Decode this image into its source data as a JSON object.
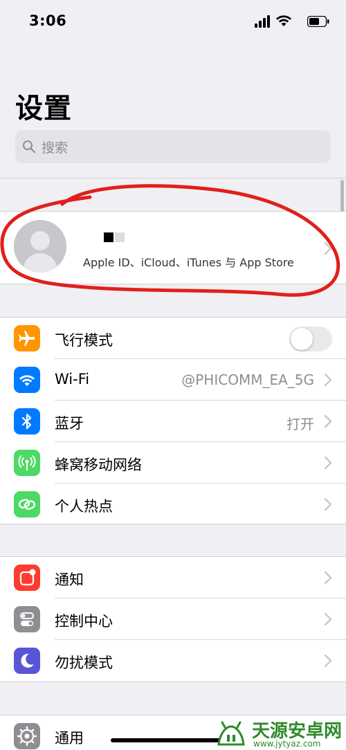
{
  "status_bar": {
    "time": "3:06"
  },
  "title": "设置",
  "search": {
    "placeholder": "搜索"
  },
  "profile": {
    "subtitle": "Apple ID、iCloud、iTunes 与 App Store"
  },
  "network_group": [
    {
      "label": "飞行模式",
      "value": "",
      "icon": "airplane-icon",
      "color": "#ff9500",
      "toggle": false
    },
    {
      "label": "Wi-Fi",
      "value": "@PHICOMM_EA_5G",
      "icon": "wifi-icon",
      "color": "#007aff"
    },
    {
      "label": "蓝牙",
      "value": "打开",
      "icon": "bluetooth-icon",
      "color": "#007aff"
    },
    {
      "label": "蜂窝移动网络",
      "value": "",
      "icon": "cellular-icon",
      "color": "#4cd964"
    },
    {
      "label": "个人热点",
      "value": "",
      "icon": "hotspot-icon",
      "color": "#4cd964"
    }
  ],
  "notify_group": [
    {
      "label": "通知",
      "icon": "notifications-icon",
      "color": "#ff3b30"
    },
    {
      "label": "控制中心",
      "icon": "control-center-icon",
      "color": "#8e8e93"
    },
    {
      "label": "勿扰模式",
      "icon": "moon-icon",
      "color": "#5856d6"
    }
  ],
  "general_group": [
    {
      "label": "通用",
      "icon": "gear-icon",
      "color": "#8e8e93"
    }
  ],
  "watermark": {
    "name": "天源安卓网",
    "url": "www.jytyaz.com",
    "color": "#2f8a2a"
  },
  "annotation_color": "#e0201b"
}
